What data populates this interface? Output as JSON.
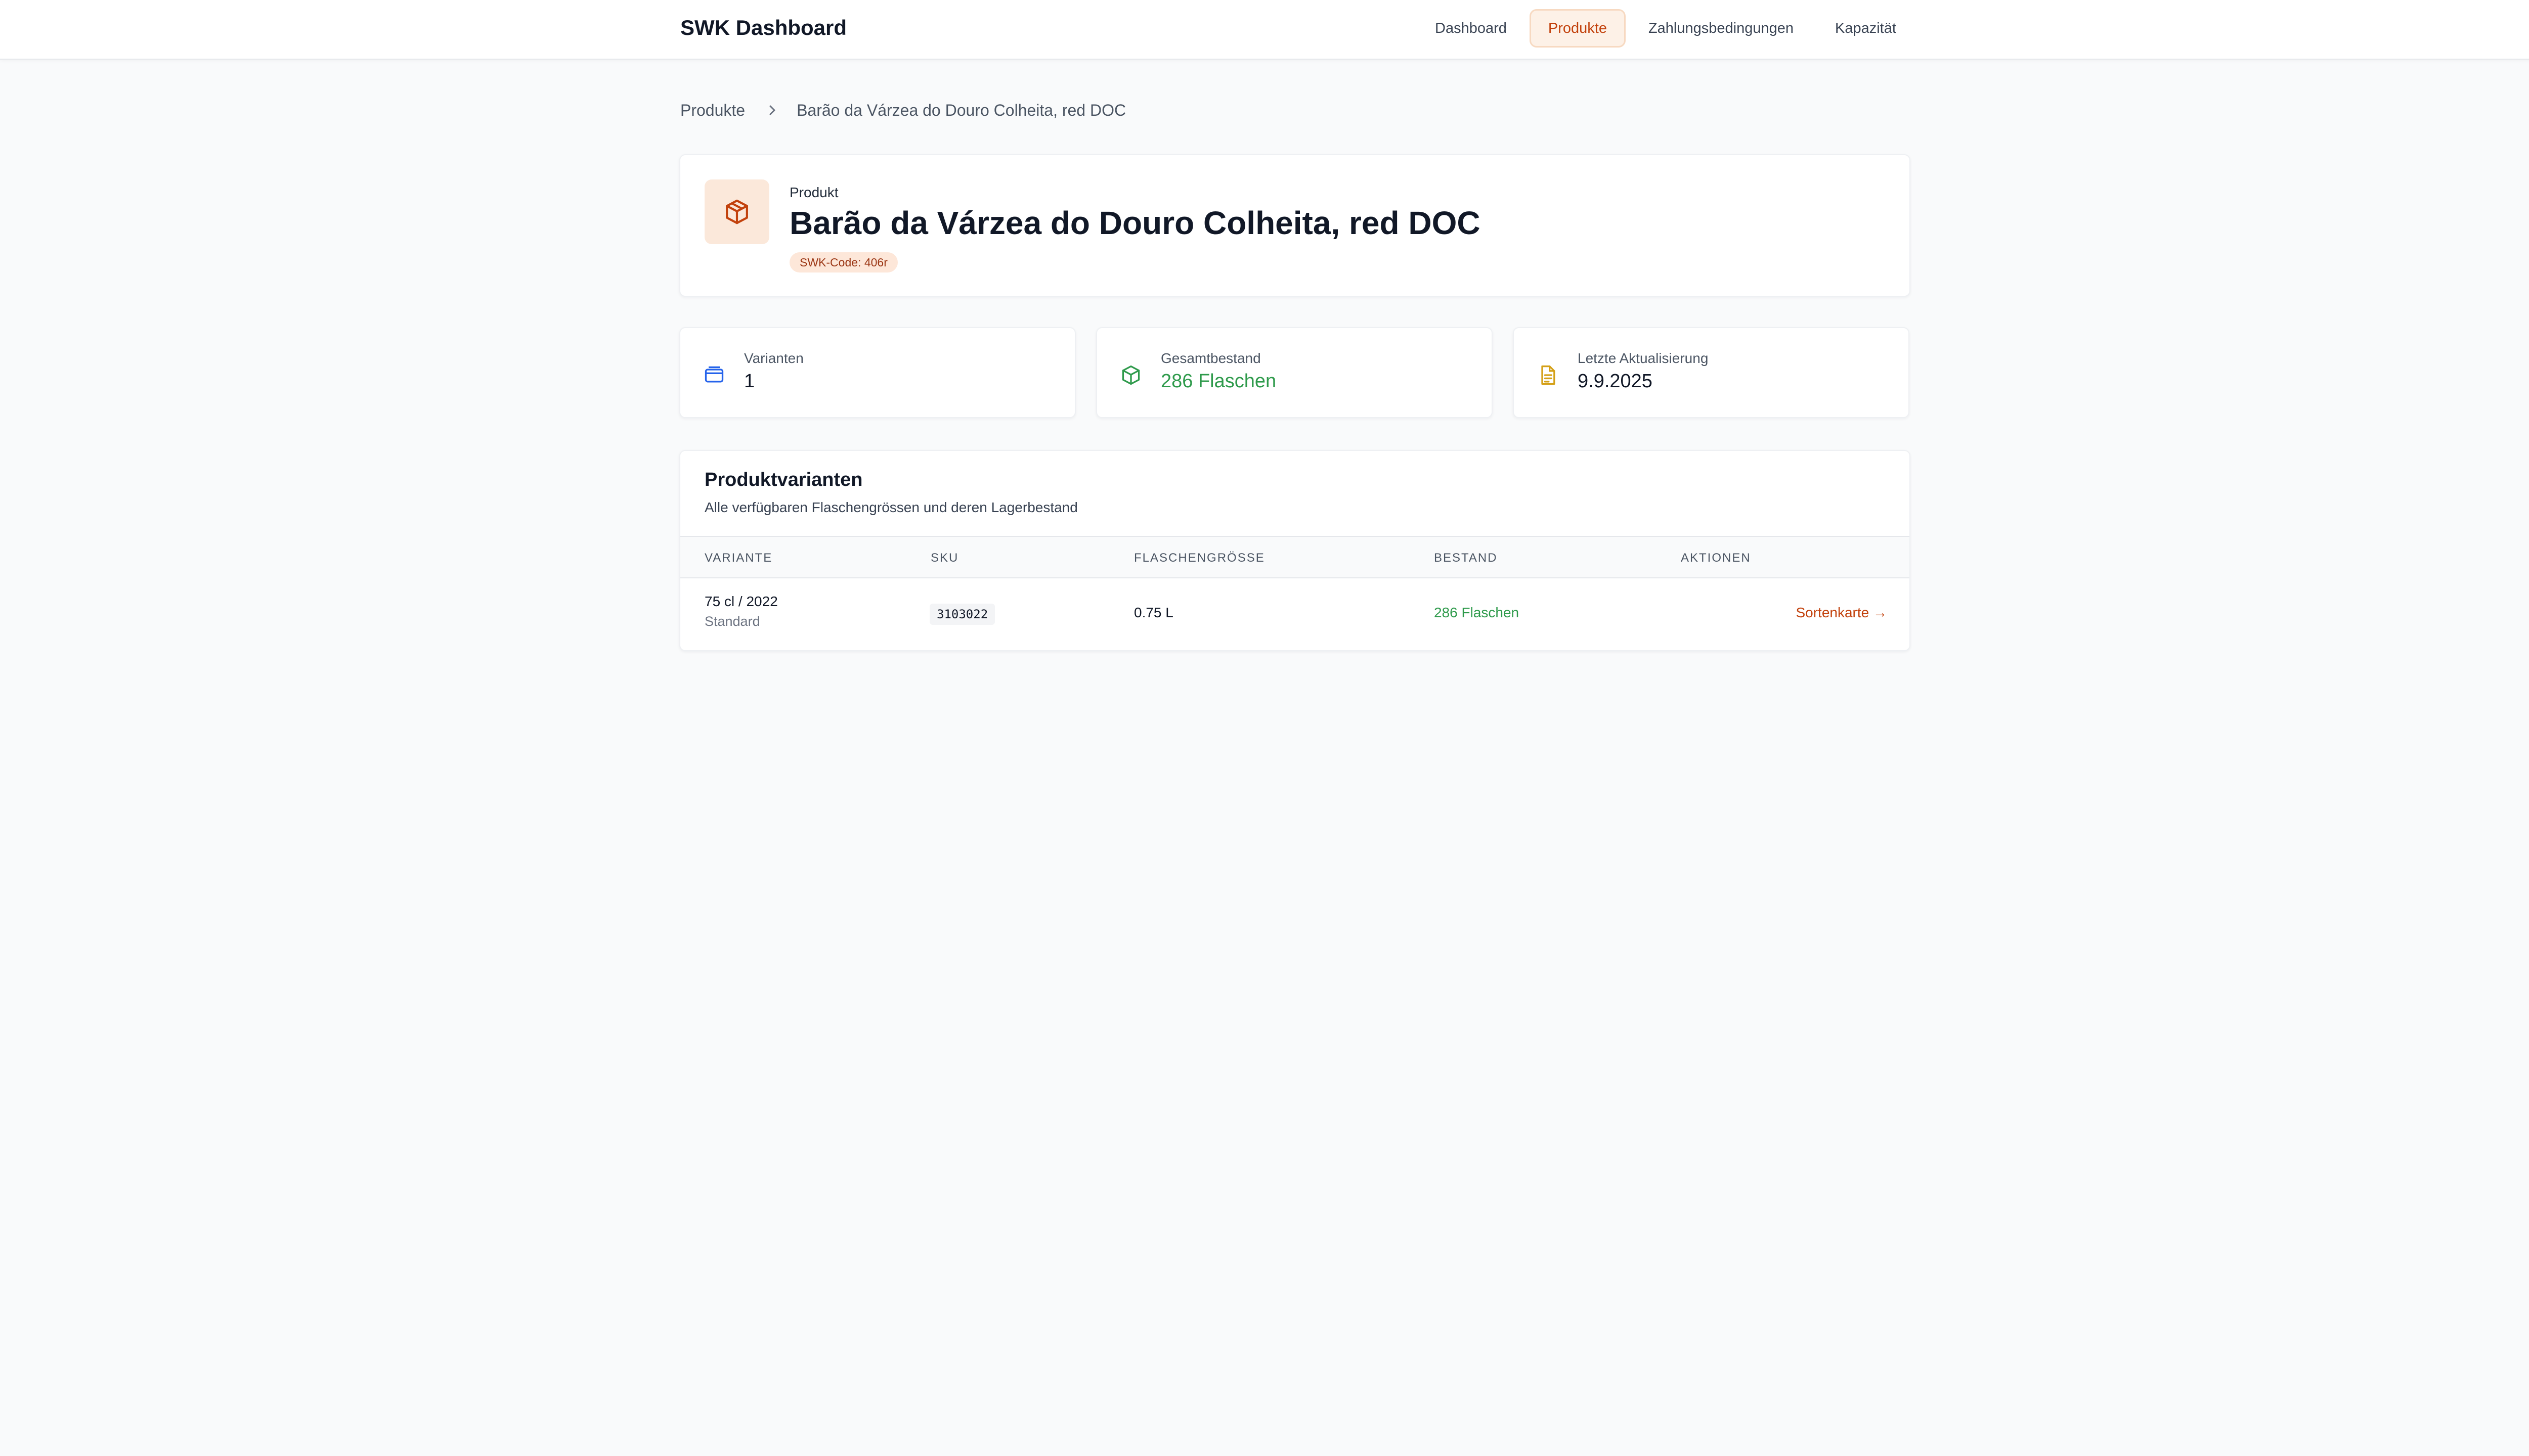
{
  "app": {
    "title": "SWK Dashboard"
  },
  "nav": [
    {
      "label": "Dashboard",
      "active": false
    },
    {
      "label": "Produkte",
      "active": true
    },
    {
      "label": "Zahlungsbedingungen",
      "active": false
    },
    {
      "label": "Kapazität",
      "active": false
    }
  ],
  "breadcrumb": {
    "parent": "Produkte",
    "current": "Barão da Várzea do Douro Colheita, red DOC"
  },
  "product": {
    "eyebrow": "Produkt",
    "name": "Barão da Várzea do Douro Colheita, red DOC",
    "code_badge": "SWK-Code: 406r"
  },
  "stats": [
    {
      "label": "Varianten",
      "value": "1",
      "icon": "card-icon"
    },
    {
      "label": "Gesamtbestand",
      "value": "286 Flaschen",
      "icon": "package-icon"
    },
    {
      "label": "Letzte Aktualisierung",
      "value": "9.9.2025",
      "icon": "document-icon"
    }
  ],
  "variants": {
    "title": "Produktvarianten",
    "subtitle": "Alle verfügbaren Flaschengrössen und deren Lagerbestand",
    "columns": [
      "VARIANTE",
      "SKU",
      "FLASCHENGRÖSSE",
      "BESTAND",
      "AKTIONEN"
    ],
    "rows": [
      {
        "variant": "75 cl / 2022",
        "variant_sub": "Standard",
        "sku": "3103022",
        "size": "0.75 L",
        "stock": "286 Flaschen",
        "action": "Sortenkarte →"
      }
    ]
  },
  "colors": {
    "accent": "#c2410c",
    "accent_bg": "#fdf1e7",
    "success": "#2e9a4b",
    "info": "#2563eb",
    "warning": "#d4a017"
  }
}
